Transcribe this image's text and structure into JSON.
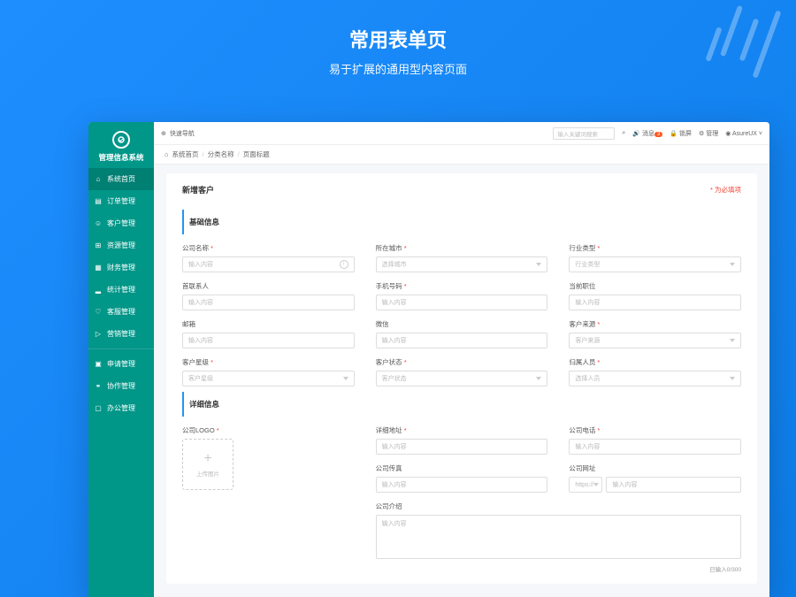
{
  "hero": {
    "title": "常用表单页",
    "subtitle": "易于扩展的通用型内容页面"
  },
  "sidebar": {
    "logo_title": "管理信息系统",
    "items": [
      {
        "icon": "home",
        "label": "系统首页",
        "active": true
      },
      {
        "icon": "doc",
        "label": "订单管理"
      },
      {
        "icon": "user",
        "label": "客户管理"
      },
      {
        "icon": "box",
        "label": "资源管理"
      },
      {
        "icon": "money",
        "label": "财务管理"
      },
      {
        "icon": "chart",
        "label": "统计管理"
      },
      {
        "icon": "support",
        "label": "客服管理"
      },
      {
        "icon": "horn",
        "label": "营销管理"
      }
    ],
    "items2": [
      {
        "icon": "file",
        "label": "申请管理"
      },
      {
        "icon": "team",
        "label": "协作管理"
      },
      {
        "icon": "monitor",
        "label": "办公管理"
      }
    ]
  },
  "topbar": {
    "quick_nav": "快速导航",
    "search_placeholder": "输入关键词搜索",
    "notif": "消息",
    "notif_count": "3",
    "lock": "锁屏",
    "manage": "管理",
    "user": "AsureUX"
  },
  "breadcrumb": {
    "home": "系统首页",
    "cat": "分类名称",
    "page": "页面标题"
  },
  "card": {
    "title": "新增客户",
    "required_note": "* 为必填项"
  },
  "sections": {
    "basic": "基础信息",
    "detail": "详细信息"
  },
  "fields": {
    "company_name": {
      "label": "公司名称",
      "placeholder": "输入内容"
    },
    "city": {
      "label": "所在城市",
      "placeholder": "选择城市"
    },
    "industry": {
      "label": "行业类型",
      "placeholder": "行业类型"
    },
    "contact": {
      "label": "首联系人",
      "placeholder": "输入内容"
    },
    "phone": {
      "label": "手机号码",
      "placeholder": "输入内容"
    },
    "position": {
      "label": "当前职位",
      "placeholder": "输入内容"
    },
    "email": {
      "label": "邮箱",
      "placeholder": "输入内容"
    },
    "wechat": {
      "label": "微信",
      "placeholder": "输入内容"
    },
    "source": {
      "label": "客户来源",
      "placeholder": "客户来源"
    },
    "stars": {
      "label": "客户星级",
      "placeholder": "客户星级"
    },
    "status": {
      "label": "客户状态",
      "placeholder": "客户状态"
    },
    "assignee": {
      "label": "归属人员",
      "placeholder": "选择人员"
    },
    "logo": {
      "label": "公司LOGO",
      "upload_text": "上传图片"
    },
    "address": {
      "label": "详细地址",
      "placeholder": "输入内容"
    },
    "tel": {
      "label": "公司电话",
      "placeholder": "输入内容"
    },
    "fax": {
      "label": "公司传真",
      "placeholder": "输入内容"
    },
    "website": {
      "label": "公司网址",
      "prefix": "https://",
      "placeholder": "输入内容"
    },
    "intro": {
      "label": "公司介绍",
      "placeholder": "输入内容",
      "count": "已输入0/300"
    }
  }
}
